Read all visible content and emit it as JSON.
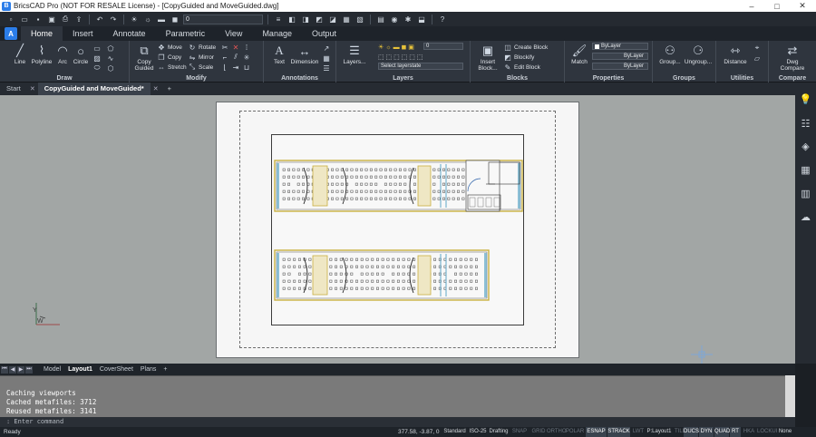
{
  "window": {
    "title": "BricsCAD Pro (NOT FOR RESALE License) - [CopyGuided and MoveGuided.dwg]",
    "app_icon": "B",
    "minimize": "–",
    "maximize": "□",
    "close": "✕"
  },
  "quick_access": {
    "layer_value": "0"
  },
  "ribbon_tabs": [
    "Home",
    "Insert",
    "Annotate",
    "Parametric",
    "View",
    "Manage",
    "Output"
  ],
  "active_ribbon_tab": "Home",
  "logo": "A",
  "ribbon": {
    "draw": {
      "title": "Draw",
      "line": "Line",
      "polyline": "Polyline",
      "arc": "Arc",
      "circle": "Circle"
    },
    "modify": {
      "title": "Modify",
      "copy_guided": "Copy\nGuided",
      "move": "Move",
      "copy": "Copy",
      "stretch": "Stretch",
      "rotate": "Rotate",
      "mirror": "Mirror",
      "scale": "Scale"
    },
    "annotations": {
      "title": "Annotations",
      "text": "Text",
      "dimension": "Dimension"
    },
    "layers": {
      "title": "Layers",
      "layers_btn": "Layers...",
      "layer_value": "0",
      "layerstate_placeholder": "Select layerstate"
    },
    "blocks": {
      "title": "Blocks",
      "insert_block": "Insert\nBlock...",
      "create_block": "Create Block",
      "blockify": "Blockify",
      "edit_block": "Edit Block"
    },
    "properties": {
      "title": "Properties",
      "match": "Match",
      "color": "ByLayer",
      "linetype": "ByLayer",
      "lineweight": "ByLayer"
    },
    "groups": {
      "title": "Groups",
      "group": "Group...",
      "ungroup": "Ungroup..."
    },
    "utilities": {
      "title": "Utilities",
      "distance": "Distance"
    },
    "compare": {
      "title": "Compare",
      "dwg_compare": "Dwg\nCompare"
    }
  },
  "doc_tabs": {
    "start": "Start",
    "active": "CopyGuided and MoveGuided*",
    "add": "+"
  },
  "layout_tabs": [
    "Model",
    "Layout1",
    "CoverSheet",
    "Plans"
  ],
  "active_layout_tab": "Layout1",
  "layout_add": "+",
  "command_history": [
    "Caching viewports",
    "Cached metafiles: 3712",
    "Reused metafiles: 3141"
  ],
  "command_prompt": ": Enter command",
  "ucs": {
    "y_label": "Y",
    "x_label": "W"
  },
  "status": {
    "left": "Ready",
    "coords": "377.58, -3.87, 0",
    "items": [
      "Standard",
      "ISO-25",
      "Drafting",
      "SNAP",
      "GRID",
      "ORTHO",
      "POLAR",
      "ESNAP",
      "STRACK",
      "LWT",
      "P:Layout1",
      "TILE",
      "DUCS",
      "DYN",
      "QUAD",
      "RT",
      "HKA",
      "LOCKUI",
      "None"
    ],
    "on_items": [
      "ESNAP",
      "STRACK",
      "DUCS",
      "DYN",
      "QUAD",
      "RT"
    ],
    "off_items": [
      "SNAP",
      "GRID",
      "ORTHO",
      "POLAR",
      "LWT",
      "TILE",
      "HKA",
      "LOCKUI"
    ]
  },
  "colors": {
    "canvas": "#a2a6a5",
    "ribbon": "#2f353e",
    "accent": "#2b7de9",
    "plan_wall": "#c9b040",
    "plan_glass": "#5fa8c8"
  }
}
